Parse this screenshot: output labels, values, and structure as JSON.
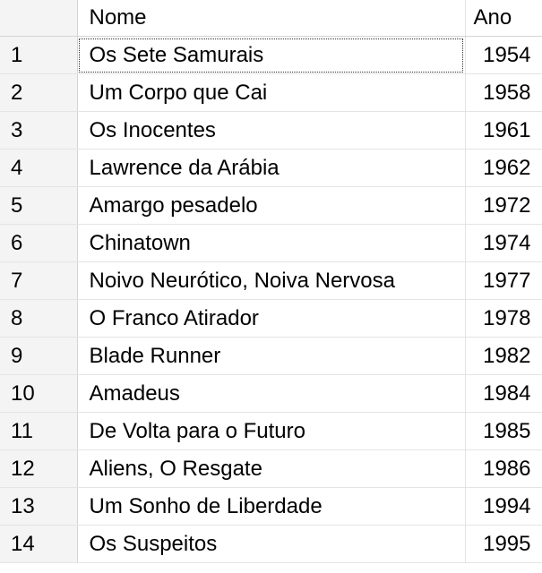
{
  "grid": {
    "columns": {
      "name": "Nome",
      "year": "Ano"
    },
    "rows": [
      {
        "num": "1",
        "name": "Os Sete Samurais",
        "year": "1954"
      },
      {
        "num": "2",
        "name": "Um Corpo que Cai",
        "year": "1958"
      },
      {
        "num": "3",
        "name": "Os Inocentes",
        "year": "1961"
      },
      {
        "num": "4",
        "name": "Lawrence da Arábia",
        "year": "1962"
      },
      {
        "num": "5",
        "name": "Amargo pesadelo",
        "year": "1972"
      },
      {
        "num": "6",
        "name": "Chinatown",
        "year": "1974"
      },
      {
        "num": "7",
        "name": "Noivo Neurótico, Noiva Nervosa",
        "year": "1977"
      },
      {
        "num": "8",
        "name": "O Franco Atirador",
        "year": "1978"
      },
      {
        "num": "9",
        "name": "Blade Runner",
        "year": "1982"
      },
      {
        "num": "10",
        "name": "Amadeus",
        "year": "1984"
      },
      {
        "num": "11",
        "name": "De Volta para o Futuro",
        "year": "1985"
      },
      {
        "num": "12",
        "name": "Aliens, O Resgate",
        "year": "1986"
      },
      {
        "num": "13",
        "name": "Um Sonho de Liberdade",
        "year": "1994"
      },
      {
        "num": "14",
        "name": "Os Suspeitos",
        "year": "1995"
      }
    ]
  }
}
